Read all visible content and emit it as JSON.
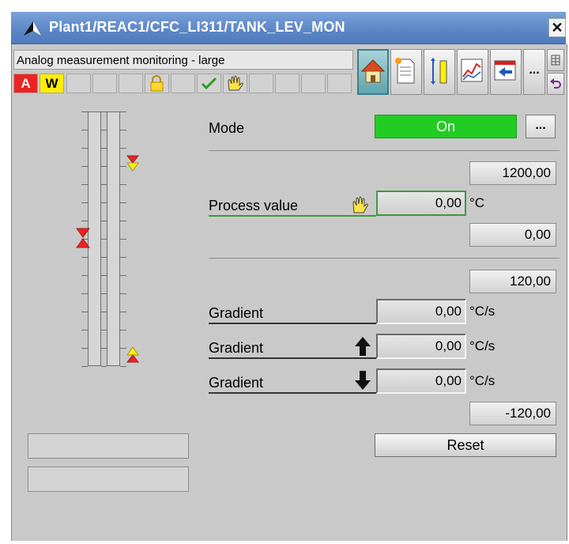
{
  "window": {
    "title": "Plant1/REAC1/CFC_LI311/TANK_LEV_MON"
  },
  "toolbar": {
    "description": "Analog measurement monitoring - large",
    "alarm_badge": "A",
    "warning_badge": "W",
    "more_label": "..."
  },
  "mode": {
    "label": "Mode",
    "value": "On",
    "more_label": "..."
  },
  "process": {
    "high_limit": "1200,00",
    "label": "Process value",
    "value": "0,00",
    "unit": "°C",
    "low_limit": "0,00"
  },
  "gradient": {
    "high_limit": "120,00",
    "rows": [
      {
        "label": "Gradient",
        "value": "0,00",
        "unit": "°C/s"
      },
      {
        "label": "Gradient",
        "value": "0,00",
        "unit": "°C/s"
      },
      {
        "label": "Gradient",
        "value": "0,00",
        "unit": "°C/s"
      }
    ],
    "low_limit": "-120,00"
  },
  "reset_label": "Reset",
  "colors": {
    "mode_on": "#22cc22",
    "alarm": "#ee2222",
    "warning": "#ffee00",
    "title_bar": "#5b86c6"
  }
}
